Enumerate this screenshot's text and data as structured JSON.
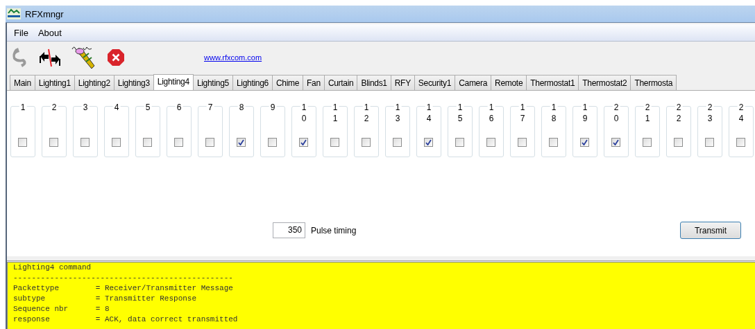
{
  "window": {
    "title": "RFXmngr"
  },
  "menu": [
    "File",
    "About"
  ],
  "toolbar": {
    "link": "www.rfxcom.com"
  },
  "tabs": [
    {
      "label": "Main",
      "selected": false
    },
    {
      "label": "Lighting1",
      "selected": false
    },
    {
      "label": "Lighting2",
      "selected": false
    },
    {
      "label": "Lighting3",
      "selected": false
    },
    {
      "label": "Lighting4",
      "selected": true
    },
    {
      "label": "Lighting5",
      "selected": false
    },
    {
      "label": "Lighting6",
      "selected": false
    },
    {
      "label": "Chime",
      "selected": false
    },
    {
      "label": "Fan",
      "selected": false
    },
    {
      "label": "Curtain",
      "selected": false
    },
    {
      "label": "Blinds1",
      "selected": false
    },
    {
      "label": "RFY",
      "selected": false
    },
    {
      "label": "Security1",
      "selected": false
    },
    {
      "label": "Camera",
      "selected": false
    },
    {
      "label": "Remote",
      "selected": false
    },
    {
      "label": "Thermostat1",
      "selected": false
    },
    {
      "label": "Thermostat2",
      "selected": false
    },
    {
      "label": "Thermosta",
      "selected": false
    }
  ],
  "bits": [
    {
      "label": "1",
      "checked": false
    },
    {
      "label": "2",
      "checked": false
    },
    {
      "label": "3",
      "checked": false
    },
    {
      "label": "4",
      "checked": false
    },
    {
      "label": "5",
      "checked": false
    },
    {
      "label": "6",
      "checked": false
    },
    {
      "label": "7",
      "checked": false
    },
    {
      "label": "8",
      "checked": true
    },
    {
      "label": "9",
      "checked": false
    },
    {
      "label": "10",
      "checked": true
    },
    {
      "label": "11",
      "checked": false
    },
    {
      "label": "12",
      "checked": false
    },
    {
      "label": "13",
      "checked": false
    },
    {
      "label": "14",
      "checked": true
    },
    {
      "label": "15",
      "checked": false
    },
    {
      "label": "16",
      "checked": false
    },
    {
      "label": "17",
      "checked": false
    },
    {
      "label": "18",
      "checked": false
    },
    {
      "label": "19",
      "checked": true
    },
    {
      "label": "20",
      "checked": true
    },
    {
      "label": "21",
      "checked": false
    },
    {
      "label": "22",
      "checked": false
    },
    {
      "label": "23",
      "checked": false
    },
    {
      "label": "24",
      "checked": false
    }
  ],
  "pulse": {
    "value": "350",
    "label": "Pulse timing"
  },
  "transmit_button": "Transmit",
  "log": [
    "Lighting4 command",
    "------------------------------------------------",
    "Packettype        = Receiver/Transmitter Message",
    "subtype           = Transmitter Response",
    "Sequence nbr      = 8",
    "response          = ACK, data correct transmitted"
  ]
}
